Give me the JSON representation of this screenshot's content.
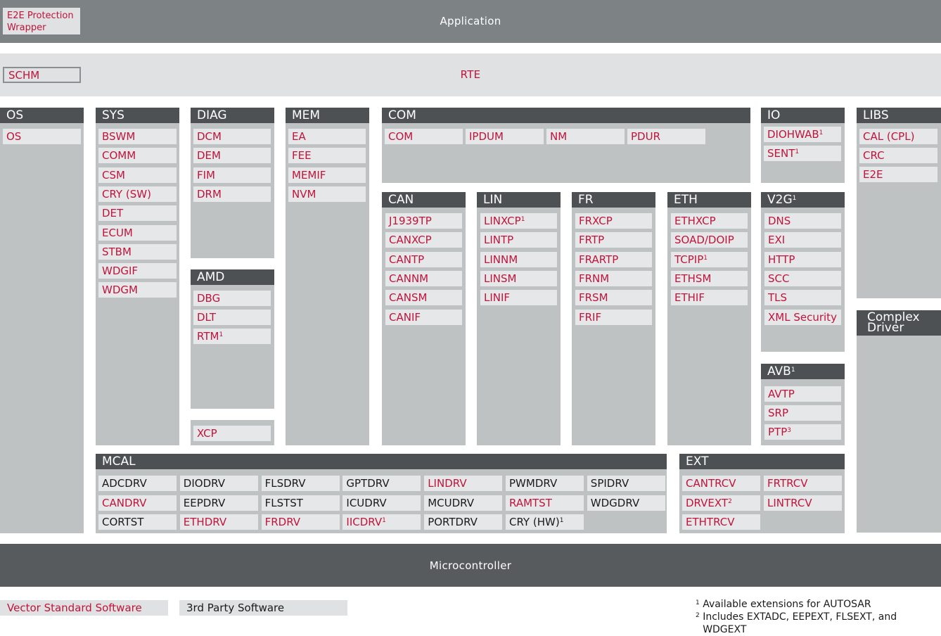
{
  "application": {
    "label": "Application",
    "wrapper": "E2E Protection\nWrapper"
  },
  "rte": {
    "label": "RTE",
    "schm": "SCHM"
  },
  "microcontroller": {
    "label": "Microcontroller"
  },
  "columns": {
    "os": {
      "title": "OS",
      "items": [
        {
          "t": "OS"
        }
      ]
    },
    "sys": {
      "title": "SYS",
      "items": [
        {
          "t": "BSWM"
        },
        {
          "t": "COMM"
        },
        {
          "t": "CSM"
        },
        {
          "t": "CRY (SW)"
        },
        {
          "t": "DET"
        },
        {
          "t": "ECUM"
        },
        {
          "t": "STBM"
        },
        {
          "t": "WDGIF"
        },
        {
          "t": "WDGM"
        }
      ]
    },
    "diag": {
      "title": "DIAG",
      "items": [
        {
          "t": "DCM"
        },
        {
          "t": "DEM"
        },
        {
          "t": "FIM"
        },
        {
          "t": "DRM"
        }
      ]
    },
    "amd": {
      "title": "AMD",
      "items": [
        {
          "t": "DBG"
        },
        {
          "t": "DLT"
        },
        {
          "t": "RTM",
          "s": "1"
        }
      ]
    },
    "xcp": {
      "items": [
        {
          "t": "XCP"
        }
      ]
    },
    "mem": {
      "title": "MEM",
      "items": [
        {
          "t": "EA"
        },
        {
          "t": "FEE"
        },
        {
          "t": "MEMIF"
        },
        {
          "t": "NVM"
        }
      ]
    },
    "com": {
      "title": "COM",
      "items": [
        {
          "t": "COM"
        },
        {
          "t": "IPDUM"
        },
        {
          "t": "NM"
        },
        {
          "t": "PDUR"
        }
      ]
    },
    "can": {
      "title": "CAN",
      "items": [
        {
          "t": "J1939TP"
        },
        {
          "t": "CANXCP"
        },
        {
          "t": "CANTP"
        },
        {
          "t": "CANNM"
        },
        {
          "t": "CANSM"
        },
        {
          "t": "CANIF"
        }
      ]
    },
    "lin": {
      "title": "LIN",
      "items": [
        {
          "t": "LINXCP",
          "s": "1"
        },
        {
          "t": "LINTP"
        },
        {
          "t": "LINNM"
        },
        {
          "t": "LINSM"
        },
        {
          "t": "LINIF"
        }
      ]
    },
    "fr": {
      "title": "FR",
      "items": [
        {
          "t": "FRXCP"
        },
        {
          "t": "FRTP"
        },
        {
          "t": "FRARTP"
        },
        {
          "t": "FRNM"
        },
        {
          "t": "FRSM"
        },
        {
          "t": "FRIF"
        }
      ]
    },
    "eth": {
      "title": "ETH",
      "items": [
        {
          "t": "ETHXCP"
        },
        {
          "t": "SOAD/DOIP"
        },
        {
          "t": "TCPIP",
          "s": "1"
        },
        {
          "t": "ETHSM"
        },
        {
          "t": "ETHIF"
        }
      ]
    },
    "io": {
      "title": "IO",
      "items": [
        {
          "t": "DIOHWAB",
          "s": "1"
        },
        {
          "t": "SENT",
          "s": "1"
        }
      ]
    },
    "v2g": {
      "title": "V2G",
      "title_sup": "1",
      "items": [
        {
          "t": "DNS"
        },
        {
          "t": "EXI"
        },
        {
          "t": "HTTP"
        },
        {
          "t": "SCC"
        },
        {
          "t": "TLS"
        },
        {
          "t": "XML Security"
        }
      ]
    },
    "avb": {
      "title": "AVB",
      "title_sup": "1",
      "items": [
        {
          "t": "AVTP"
        },
        {
          "t": "SRP"
        },
        {
          "t": "PTP",
          "s": "3"
        }
      ]
    },
    "libs": {
      "title": "LIBS",
      "items": [
        {
          "t": "CAL (CPL)"
        },
        {
          "t": "CRC"
        },
        {
          "t": "E2E"
        }
      ]
    },
    "complex": {
      "title": "Complex\nDriver"
    }
  },
  "mcal": {
    "title": "MCAL",
    "rows": [
      [
        {
          "t": "ADCDRV",
          "c": "b"
        },
        {
          "t": "DIODRV",
          "c": "b"
        },
        {
          "t": "FLSDRV",
          "c": "b"
        },
        {
          "t": "GPTDRV",
          "c": "b"
        },
        {
          "t": "LINDRV",
          "c": "r"
        },
        {
          "t": "PWMDRV",
          "c": "b"
        },
        {
          "t": "SPIDRV",
          "c": "b"
        }
      ],
      [
        {
          "t": "CANDRV",
          "c": "r"
        },
        {
          "t": "EEPDRV",
          "c": "b"
        },
        {
          "t": "FLSTST",
          "c": "b"
        },
        {
          "t": "ICUDRV",
          "c": "b"
        },
        {
          "t": "MCUDRV",
          "c": "b"
        },
        {
          "t": "RAMTST",
          "c": "r"
        },
        {
          "t": "WDGDRV",
          "c": "b"
        }
      ],
      [
        {
          "t": "CORTST",
          "c": "b"
        },
        {
          "t": "ETHDRV",
          "c": "r"
        },
        {
          "t": "FRDRV",
          "c": "r"
        },
        {
          "t": "IICDRV",
          "c": "r",
          "s": "1"
        },
        {
          "t": "PORTDRV",
          "c": "b"
        },
        {
          "t": "CRY (HW)",
          "c": "b",
          "s": "1"
        }
      ]
    ]
  },
  "ext": {
    "title": "EXT",
    "rows": [
      [
        {
          "t": "CANTRCV"
        },
        {
          "t": "FRTRCV"
        }
      ],
      [
        {
          "t": "DRVEXT",
          "s": "2"
        },
        {
          "t": "LINTRCV"
        }
      ],
      [
        {
          "t": "ETHTRCV"
        }
      ]
    ]
  },
  "legend": {
    "vector": "Vector Standard Software",
    "third": "3rd Party Software"
  },
  "footnotes": [
    {
      "sup": "1",
      "text": "Available extensions for AUTOSAR"
    },
    {
      "sup": "2",
      "text": "Includes EXTADC, EEPEXT, FLSEXT, and\nWDGEXT"
    }
  ],
  "colors": {
    "vector_red": "#c0143c",
    "dark_band": "#7d8385",
    "light_band": "#dfe1e2",
    "column_bg": "#bfc2c3",
    "header": "#4d5153",
    "micro": "#575b5d"
  }
}
